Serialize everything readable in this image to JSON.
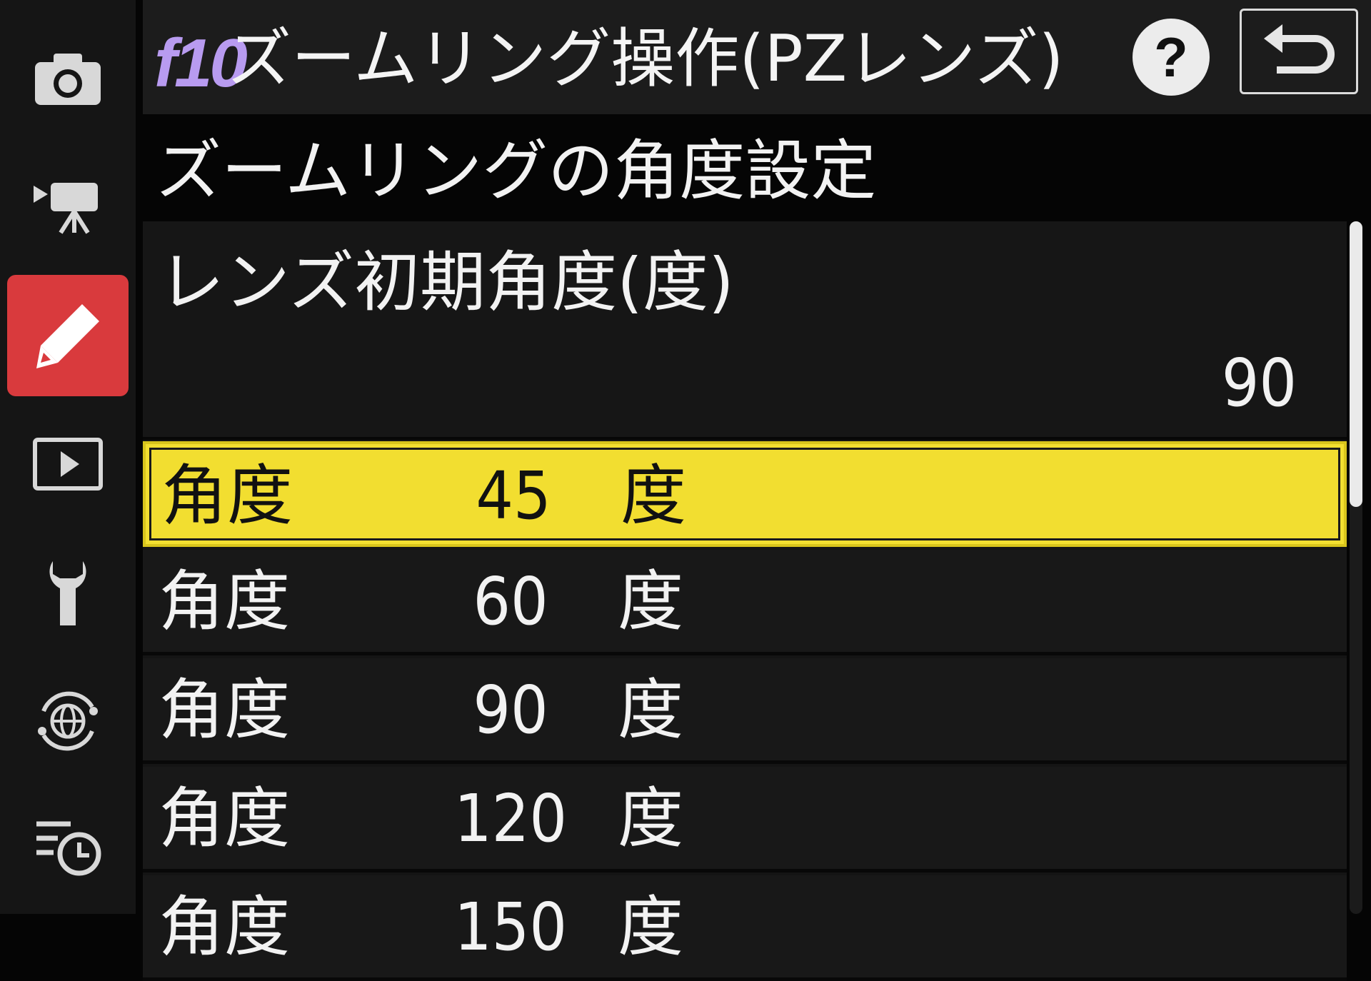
{
  "sidebar": {
    "items": [
      {
        "icon": "camera-icon"
      },
      {
        "icon": "video-camera-icon"
      },
      {
        "icon": "pencil-icon",
        "active": true
      },
      {
        "icon": "playback-icon"
      },
      {
        "icon": "wrench-icon"
      },
      {
        "icon": "network-globe-icon"
      },
      {
        "icon": "recent-settings-icon"
      }
    ]
  },
  "header": {
    "menu_code": "f10",
    "title": "ズームリング操作(PZレンズ)",
    "help_label": "?",
    "help_icon": "help-icon",
    "back_icon": "return-arrow-icon"
  },
  "section": {
    "title": "ズームリングの角度設定"
  },
  "initial_angle": {
    "label": "レンズ初期角度(度)",
    "value": "90"
  },
  "options": [
    {
      "prefix": "角度",
      "value": "45",
      "unit": "度",
      "selected": true
    },
    {
      "prefix": "角度",
      "value": "60",
      "unit": "度"
    },
    {
      "prefix": "角度",
      "value": "90",
      "unit": "度"
    },
    {
      "prefix": "角度",
      "value": "120",
      "unit": "度"
    },
    {
      "prefix": "角度",
      "value": "150",
      "unit": "度"
    }
  ],
  "colors": {
    "accent_active_tab": "#d93a3d",
    "selection_highlight": "#f2de30",
    "menu_code": "#b89bf0",
    "background": "#050505"
  },
  "scroll": {
    "position_fraction": 0.0,
    "visible_fraction": 0.41
  }
}
